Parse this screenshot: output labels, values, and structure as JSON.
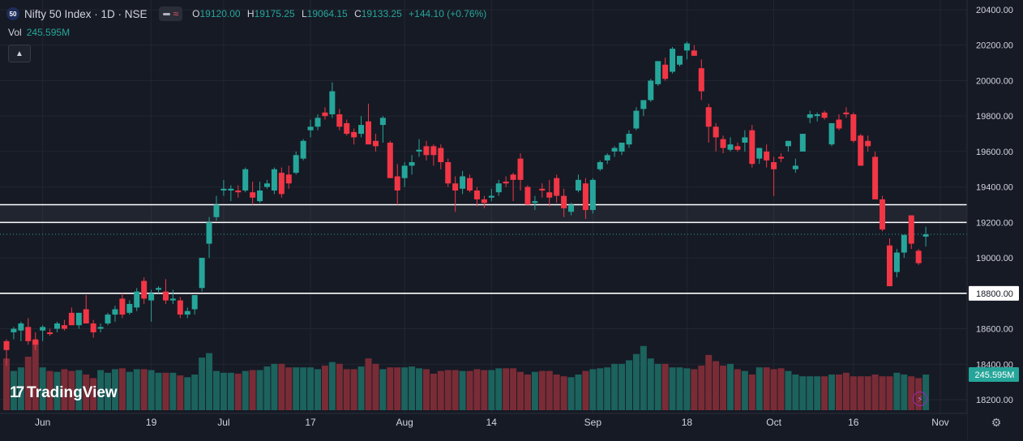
{
  "header": {
    "symbol_badge": "50",
    "title": "Nifty 50 Index · 1D · NSE",
    "open_label": "O",
    "open": "19120.00",
    "high_label": "H",
    "high": "19175.25",
    "low_label": "L",
    "low": "19064.15",
    "close_label": "C",
    "close": "19133.25",
    "change": "+144.10 (+0.76%)"
  },
  "volume_legend": {
    "label": "Vol",
    "value": "245.595M"
  },
  "brand": {
    "logo_text": "TradingView"
  },
  "icons": {
    "collapse": "chevron-up-icon",
    "flash": "lightning-icon",
    "settings": "gear-icon",
    "logo": "tradingview-logo-icon"
  },
  "colors": {
    "up": "#26a69a",
    "down": "#f23645",
    "background": "#161a25",
    "volume_up": "#1c625d",
    "volume_down": "#7a2c36",
    "grid": "#222631",
    "text": "#d1d4dc"
  },
  "chart_data": {
    "type": "candlestick",
    "y_axis": {
      "ticks": [
        "20400.00",
        "20200.00",
        "20000.00",
        "19800.00",
        "19600.00",
        "19400.00",
        "19200.00",
        "19000.00",
        "18800.00",
        "18600.00",
        "18400.00",
        "18200.00"
      ],
      "tick_values": [
        20400,
        20200,
        20000,
        19800,
        19600,
        19400,
        19200,
        19000,
        18800,
        18600,
        18400,
        18200
      ],
      "range": [
        18180,
        20480
      ]
    },
    "x_axis": {
      "labels": [
        "Jun",
        "19",
        "Jul",
        "17",
        "Aug",
        "14",
        "Sep",
        "18",
        "Oct",
        "16",
        "Nov"
      ],
      "label_candle_index": [
        5,
        20,
        30,
        42,
        55,
        67,
        81,
        94,
        106,
        117,
        129
      ]
    },
    "horizontal_levels": [
      19300,
      19200,
      18800
    ],
    "level_labels": {
      "18800": "18800.00"
    },
    "last_price": 19133.25,
    "volume_label": "245.595M",
    "candles": [
      [
        18530,
        18540,
        18390,
        18480
      ],
      [
        18580,
        18610,
        18540,
        18600
      ],
      [
        18590,
        18640,
        18530,
        18630
      ],
      [
        18610,
        18660,
        18510,
        18530
      ],
      [
        18540,
        18580,
        18480,
        18510
      ],
      [
        18590,
        18620,
        18530,
        18610
      ],
      [
        18580,
        18600,
        18560,
        18570
      ],
      [
        18600,
        18640,
        18580,
        18630
      ],
      [
        18620,
        18650,
        18590,
        18600
      ],
      [
        18690,
        18720,
        18620,
        18620
      ],
      [
        18620,
        18690,
        18600,
        18690
      ],
      [
        18710,
        18790,
        18640,
        18630
      ],
      [
        18630,
        18650,
        18550,
        18580
      ],
      [
        18600,
        18630,
        18580,
        18610
      ],
      [
        18630,
        18690,
        18620,
        18680
      ],
      [
        18680,
        18730,
        18640,
        18710
      ],
      [
        18770,
        18800,
        18660,
        18680
      ],
      [
        18690,
        18760,
        18680,
        18740
      ],
      [
        18720,
        18830,
        18700,
        18810
      ],
      [
        18870,
        18890,
        18740,
        18770
      ],
      [
        18760,
        18820,
        18640,
        18800
      ],
      [
        18820,
        18840,
        18800,
        18830
      ],
      [
        18810,
        18880,
        18740,
        18760
      ],
      [
        18760,
        18820,
        18740,
        18770
      ],
      [
        18760,
        18780,
        18660,
        18680
      ],
      [
        18680,
        18720,
        18660,
        18700
      ],
      [
        18710,
        18790,
        18680,
        18790
      ],
      [
        18830,
        18990,
        18810,
        19000
      ],
      [
        19080,
        19230,
        19000,
        19200
      ],
      [
        19230,
        19350,
        19210,
        19300
      ],
      [
        19380,
        19440,
        19350,
        19390
      ],
      [
        19380,
        19410,
        19320,
        19390
      ],
      [
        19380,
        19410,
        19340,
        19370
      ],
      [
        19380,
        19510,
        19370,
        19500
      ],
      [
        19370,
        19430,
        19300,
        19340
      ],
      [
        19320,
        19430,
        19310,
        19380
      ],
      [
        19400,
        19440,
        19390,
        19420
      ],
      [
        19380,
        19510,
        19360,
        19500
      ],
      [
        19480,
        19510,
        19340,
        19360
      ],
      [
        19470,
        19520,
        19390,
        19420
      ],
      [
        19480,
        19600,
        19470,
        19580
      ],
      [
        19560,
        19670,
        19550,
        19660
      ],
      [
        19720,
        19780,
        19680,
        19740
      ],
      [
        19740,
        19810,
        19720,
        19790
      ],
      [
        19820,
        19850,
        19780,
        19800
      ],
      [
        19810,
        19990,
        19790,
        19940
      ],
      [
        19810,
        19840,
        19720,
        19740
      ],
      [
        19760,
        19780,
        19690,
        19700
      ],
      [
        19710,
        19730,
        19640,
        19680
      ],
      [
        19700,
        19800,
        19680,
        19750
      ],
      [
        19770,
        19870,
        19650,
        19640
      ],
      [
        19660,
        19700,
        19600,
        19630
      ],
      [
        19750,
        19800,
        19650,
        19790
      ],
      [
        19650,
        19660,
        19500,
        19450
      ],
      [
        19460,
        19530,
        19300,
        19380
      ],
      [
        19450,
        19540,
        19400,
        19520
      ],
      [
        19520,
        19580,
        19470,
        19540
      ],
      [
        19600,
        19670,
        19570,
        19610
      ],
      [
        19630,
        19660,
        19550,
        19580
      ],
      [
        19630,
        19640,
        19520,
        19580
      ],
      [
        19620,
        19640,
        19500,
        19540
      ],
      [
        19540,
        19560,
        19400,
        19420
      ],
      [
        19420,
        19460,
        19260,
        19380
      ],
      [
        19390,
        19490,
        19360,
        19460
      ],
      [
        19450,
        19470,
        19370,
        19380
      ],
      [
        19380,
        19400,
        19290,
        19330
      ],
      [
        19330,
        19350,
        19280,
        19310
      ],
      [
        19340,
        19390,
        19320,
        19350
      ],
      [
        19370,
        19440,
        19350,
        19420
      ],
      [
        19430,
        19460,
        19400,
        19420
      ],
      [
        19470,
        19480,
        19320,
        19440
      ],
      [
        19560,
        19590,
        19380,
        19440
      ],
      [
        19400,
        19410,
        19310,
        19300
      ],
      [
        19310,
        19350,
        19270,
        19320
      ],
      [
        19390,
        19420,
        19340,
        19380
      ],
      [
        19370,
        19440,
        19290,
        19340
      ],
      [
        19450,
        19470,
        19310,
        19350
      ],
      [
        19350,
        19390,
        19230,
        19280
      ],
      [
        19260,
        19310,
        19240,
        19300
      ],
      [
        19380,
        19470,
        19370,
        19440
      ],
      [
        19420,
        19450,
        19220,
        19270
      ],
      [
        19270,
        19450,
        19250,
        19440
      ],
      [
        19500,
        19550,
        19490,
        19540
      ],
      [
        19550,
        19590,
        19530,
        19580
      ],
      [
        19600,
        19630,
        19570,
        19620
      ],
      [
        19600,
        19640,
        19580,
        19650
      ],
      [
        19640,
        19720,
        19620,
        19700
      ],
      [
        19730,
        19850,
        19720,
        19830
      ],
      [
        19840,
        19850,
        19800,
        19890
      ],
      [
        19890,
        20010,
        19880,
        20000
      ],
      [
        19980,
        20110,
        19970,
        20110
      ],
      [
        20090,
        20130,
        20000,
        20010
      ],
      [
        20050,
        20190,
        20040,
        20180
      ],
      [
        20090,
        20130,
        20080,
        20140
      ],
      [
        20170,
        20220,
        20120,
        20210
      ],
      [
        20170,
        20200,
        20140,
        20140
      ],
      [
        20070,
        20120,
        19890,
        19940
      ],
      [
        19850,
        19870,
        19650,
        19740
      ],
      [
        19740,
        19760,
        19600,
        19680
      ],
      [
        19670,
        19690,
        19590,
        19620
      ],
      [
        19610,
        19680,
        19600,
        19640
      ],
      [
        19630,
        19650,
        19600,
        19610
      ],
      [
        19650,
        19720,
        19600,
        19680
      ],
      [
        19720,
        19750,
        19510,
        19530
      ],
      [
        19560,
        19620,
        19530,
        19620
      ],
      [
        19600,
        19640,
        19510,
        19550
      ],
      [
        19540,
        19570,
        19350,
        19500
      ],
      [
        19570,
        19590,
        19540,
        19560
      ],
      [
        19630,
        19660,
        19600,
        19660
      ],
      [
        19500,
        19560,
        19480,
        19520
      ],
      [
        19600,
        19700,
        19600,
        19700
      ],
      [
        19790,
        19830,
        19760,
        19810
      ],
      [
        19800,
        19820,
        19770,
        19810
      ],
      [
        19820,
        19830,
        19780,
        19790
      ],
      [
        19640,
        19760,
        19630,
        19760
      ],
      [
        19780,
        19810,
        19720,
        19730
      ],
      [
        19820,
        19850,
        19790,
        19810
      ],
      [
        19810,
        19820,
        19650,
        19660
      ],
      [
        19690,
        19700,
        19520,
        19520
      ],
      [
        19660,
        19690,
        19600,
        19630
      ],
      [
        19570,
        19600,
        19340,
        19330
      ],
      [
        19330,
        19350,
        19150,
        19160
      ],
      [
        19070,
        19110,
        18850,
        18840
      ],
      [
        18920,
        19050,
        18890,
        19030
      ],
      [
        19030,
        19100,
        19000,
        19130
      ],
      [
        19240,
        19230,
        19050,
        19080
      ],
      [
        19040,
        19050,
        18960,
        18970
      ],
      [
        19120,
        19175,
        19064,
        19133
      ]
    ],
    "volumes": [
      0.58,
      0.44,
      0.48,
      0.6,
      0.78,
      0.48,
      0.44,
      0.43,
      0.46,
      0.44,
      0.45,
      0.4,
      0.36,
      0.45,
      0.42,
      0.46,
      0.47,
      0.43,
      0.46,
      0.46,
      0.45,
      0.42,
      0.42,
      0.42,
      0.39,
      0.37,
      0.4,
      0.59,
      0.64,
      0.44,
      0.42,
      0.42,
      0.41,
      0.44,
      0.45,
      0.45,
      0.49,
      0.52,
      0.52,
      0.48,
      0.48,
      0.48,
      0.48,
      0.46,
      0.5,
      0.54,
      0.52,
      0.46,
      0.46,
      0.49,
      0.58,
      0.52,
      0.46,
      0.48,
      0.48,
      0.48,
      0.49,
      0.47,
      0.46,
      0.41,
      0.44,
      0.45,
      0.45,
      0.44,
      0.44,
      0.46,
      0.45,
      0.45,
      0.47,
      0.47,
      0.47,
      0.43,
      0.4,
      0.43,
      0.44,
      0.44,
      0.4,
      0.38,
      0.37,
      0.4,
      0.44,
      0.46,
      0.47,
      0.48,
      0.52,
      0.52,
      0.56,
      0.63,
      0.72,
      0.58,
      0.52,
      0.52,
      0.48,
      0.48,
      0.47,
      0.46,
      0.5,
      0.62,
      0.55,
      0.5,
      0.52,
      0.46,
      0.44,
      0.4,
      0.48,
      0.48,
      0.46,
      0.47,
      0.44,
      0.4,
      0.38,
      0.38,
      0.38,
      0.38,
      0.4,
      0.4,
      0.42,
      0.38,
      0.38,
      0.38,
      0.4,
      0.38,
      0.38,
      0.42,
      0.4,
      0.38,
      0.36,
      0.4
    ]
  }
}
